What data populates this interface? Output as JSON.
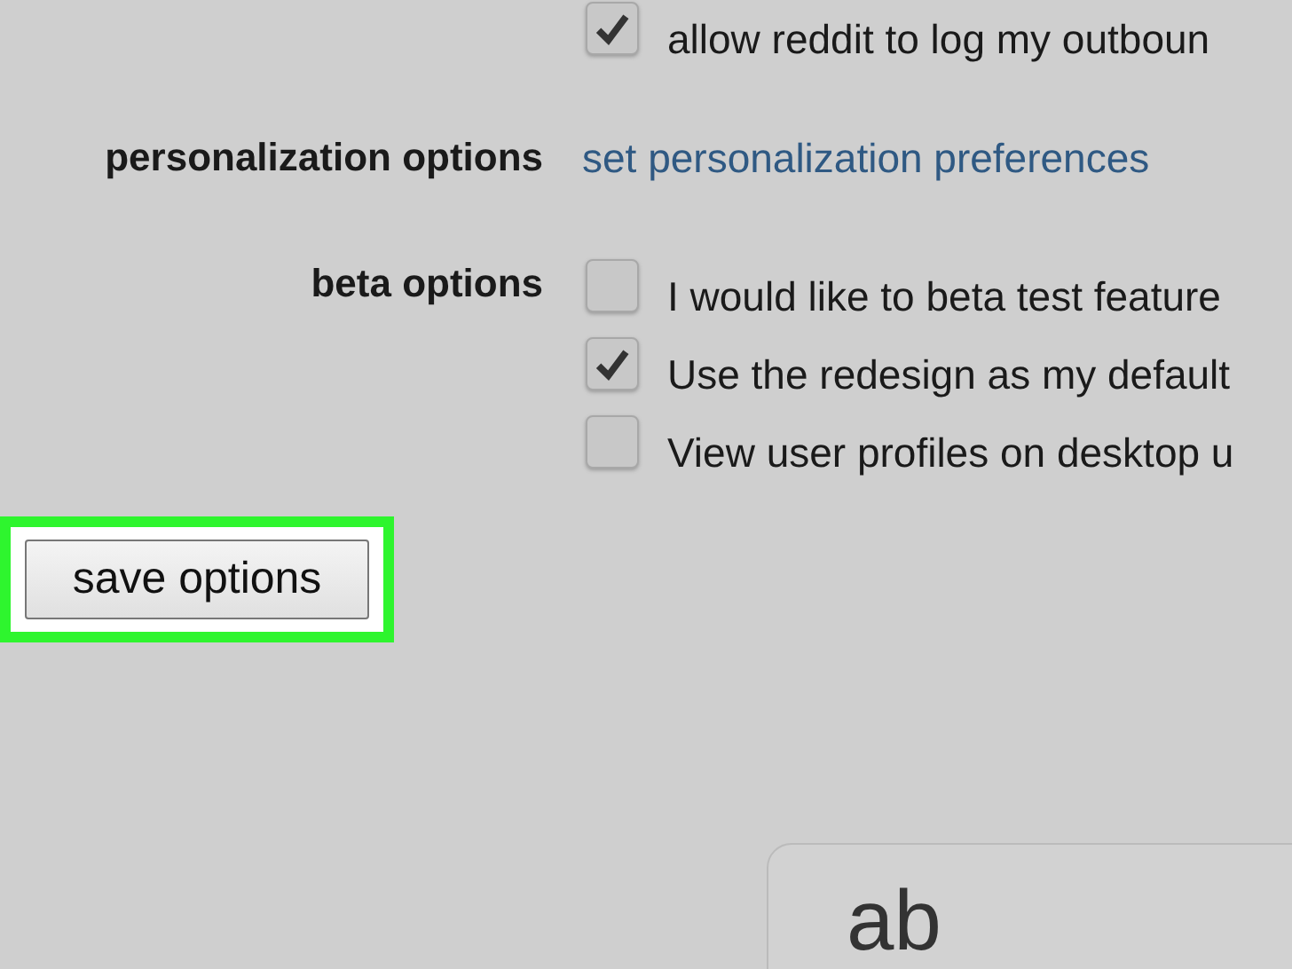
{
  "privacy_options": [
    {
      "label": "allow reddit to log my outboun",
      "checked": true
    }
  ],
  "personalization": {
    "label": "personalization options",
    "link": "set personalization preferences"
  },
  "beta": {
    "label": "beta options",
    "options": [
      {
        "label": "I would like to beta test feature",
        "checked": false
      },
      {
        "label": "Use the redesign as my default",
        "checked": true
      },
      {
        "label": "View user profiles on desktop u",
        "checked": false
      }
    ]
  },
  "save_button": {
    "label": "save options",
    "highlighted": true
  },
  "footer_box": {
    "text": "ab"
  }
}
